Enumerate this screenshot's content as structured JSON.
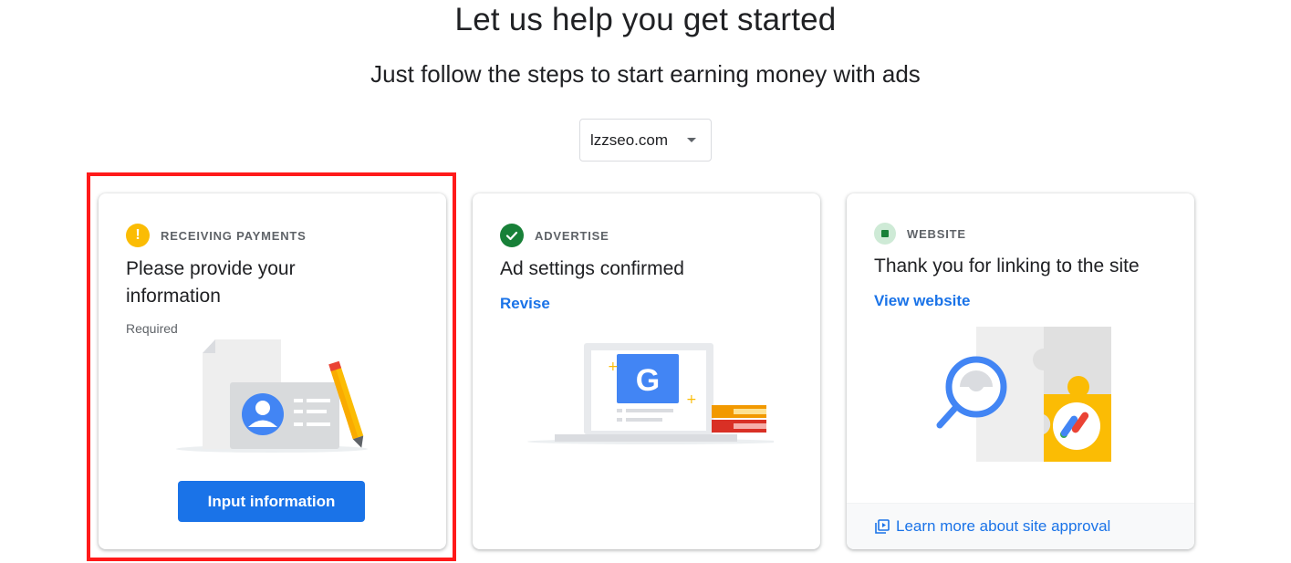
{
  "header": {
    "title": "Let us help you get started",
    "subtitle": "Just follow the steps to start earning money with ads"
  },
  "site_selector": {
    "value": "lzzseo.com"
  },
  "cards": {
    "payments": {
      "label": "RECEIVING PAYMENTS",
      "title": "Please provide your information",
      "required": "Required",
      "button": "Input information",
      "status_icon": "warning-icon"
    },
    "advertise": {
      "label": "ADVERTISE",
      "title": "Ad settings confirmed",
      "link": "Revise",
      "status_icon": "check-circle-icon"
    },
    "website": {
      "label": "WEBSITE",
      "title": "Thank you for linking to the site",
      "link": "View website",
      "footer_link": "Learn more about site approval",
      "status_icon": "site-status-icon"
    }
  },
  "colors": {
    "accent": "#1a73e8",
    "warning": "#fbbc04",
    "success": "#188038",
    "highlight": "#ff1a1a"
  }
}
